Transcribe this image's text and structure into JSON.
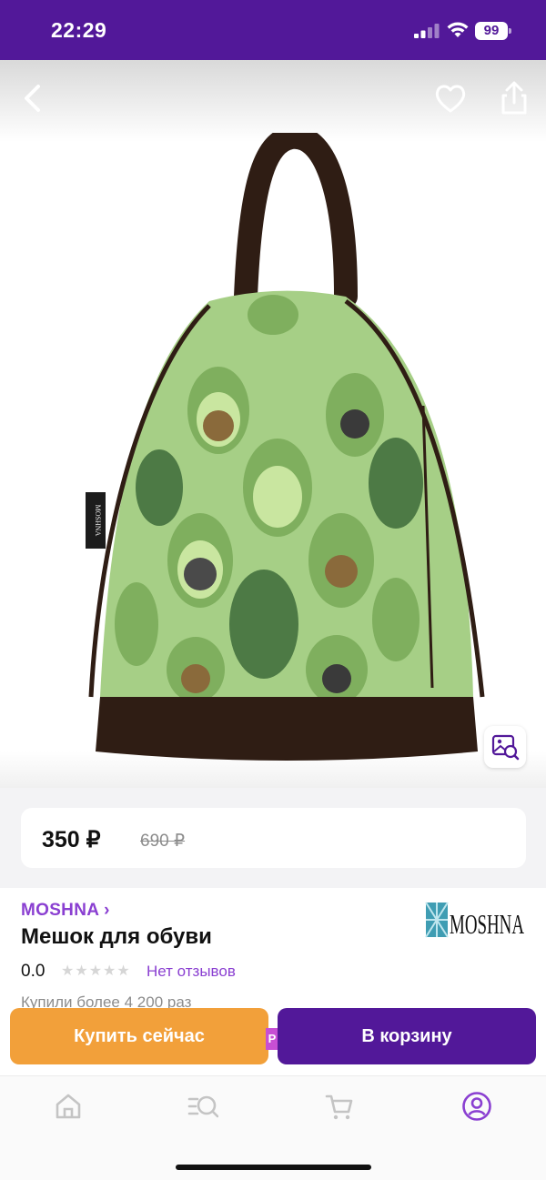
{
  "status_bar": {
    "time": "22:29",
    "battery": "99"
  },
  "gallery": {
    "brand_tag": "MOSHNA"
  },
  "price": {
    "current": "350 ₽",
    "old": "690 ₽"
  },
  "product": {
    "brand": "MOSHNA ›",
    "title": "Мешок для обуви",
    "rating": "0.0",
    "stars": "★★★★★",
    "reviews": "Нет отзывов",
    "bought": "Купили более 4 200 раз",
    "brand_logo": "MOSHNA"
  },
  "actions": {
    "buy_now": "Купить сейчас",
    "add_to_cart": "В корзину",
    "promo_tag": "P"
  },
  "colors": {
    "brand_purple": "#521899",
    "accent_purple": "#8a3fd1",
    "buy_orange": "#f2a03a"
  },
  "icons": {
    "back": "chevron-left-icon",
    "favorite": "heart-icon",
    "share": "share-icon",
    "visual_search": "image-search-icon",
    "home": "home-icon",
    "catalog": "catalog-search-icon",
    "cart": "cart-icon",
    "profile": "profile-icon"
  }
}
